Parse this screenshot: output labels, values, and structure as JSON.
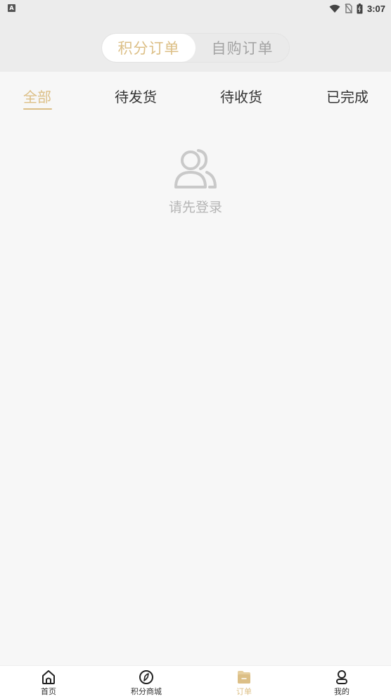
{
  "status_bar": {
    "app_badge": "A",
    "time": "3:07",
    "icons": [
      "wifi-icon",
      "no-sim-icon",
      "battery-icon"
    ]
  },
  "header": {
    "segments": [
      {
        "label": "积分订单",
        "active": true
      },
      {
        "label": "自购订单",
        "active": false
      }
    ]
  },
  "tabs": [
    {
      "label": "全部",
      "active": true
    },
    {
      "label": "待发货",
      "active": false
    },
    {
      "label": "待收货",
      "active": false
    },
    {
      "label": "已完成",
      "active": false
    }
  ],
  "empty_state": {
    "icon": "user-group-icon",
    "text": "请先登录"
  },
  "bottom_nav": [
    {
      "label": "首页",
      "icon": "home-icon",
      "active": false
    },
    {
      "label": "积分商城",
      "icon": "compass-icon",
      "active": false
    },
    {
      "label": "订单",
      "icon": "order-folder-icon",
      "active": true
    },
    {
      "label": "我的",
      "icon": "profile-icon",
      "active": false
    }
  ],
  "colors": {
    "accent": "#dcbf86",
    "background": "#f7f7f7",
    "header_bg": "#ececec",
    "text_primary": "#333333",
    "text_muted": "#b5b5b5"
  }
}
